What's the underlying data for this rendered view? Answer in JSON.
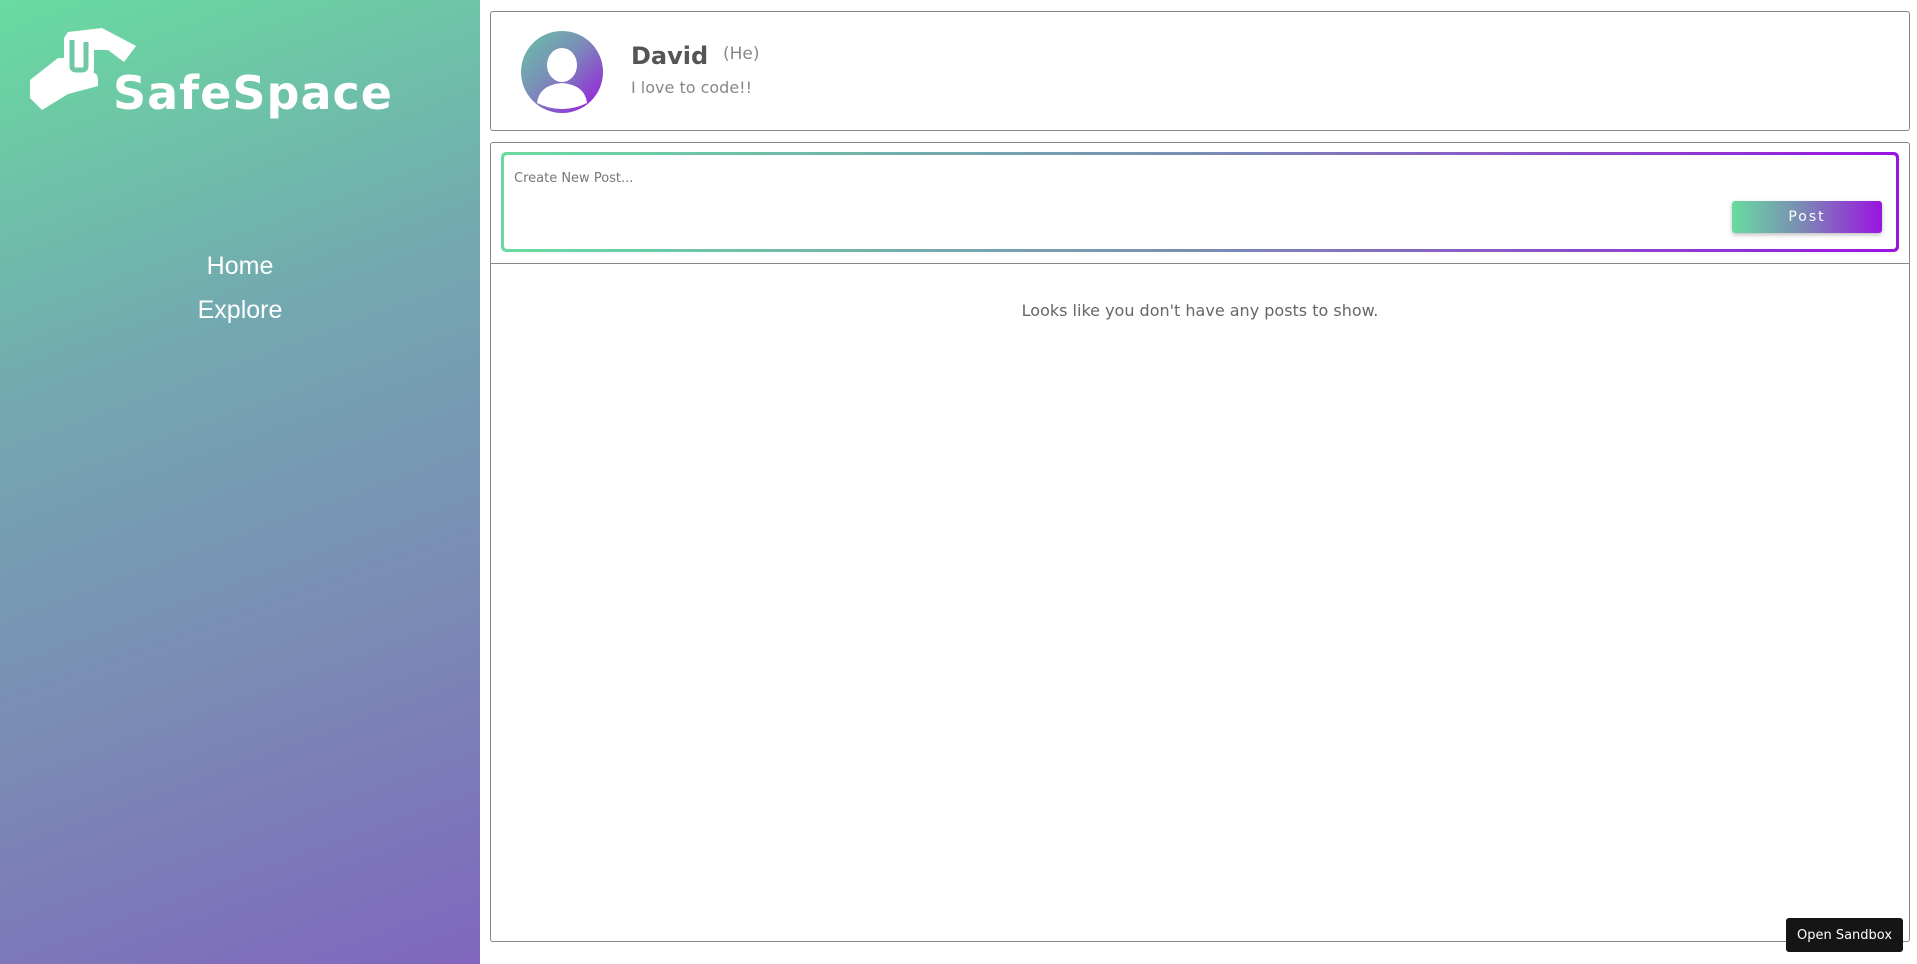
{
  "sidebar": {
    "logo_text": "SafeSpace",
    "nav": [
      {
        "label": "Home"
      },
      {
        "label": "Explore"
      }
    ],
    "gradient": [
      "#69dba0",
      "#7f67bd"
    ]
  },
  "profile": {
    "name": "David",
    "pronoun": "(He)",
    "bio": "I love to code!!"
  },
  "composer": {
    "placeholder": "Create New Post...",
    "value": "",
    "post_label": "Post"
  },
  "feed": {
    "empty_message": "Looks like you don't have any posts to show."
  },
  "sandbox": {
    "label": "Open Sandbox"
  },
  "colors": {
    "accent_green": "#69dba0",
    "accent_purple": "#9a14e0",
    "text": "#555555"
  }
}
